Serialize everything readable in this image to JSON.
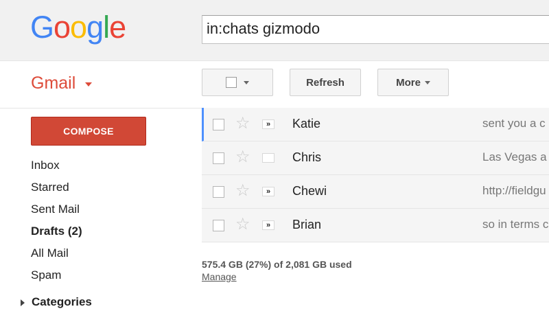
{
  "logo": {
    "letters": [
      "G",
      "o",
      "o",
      "g",
      "l",
      "e"
    ],
    "colors": [
      "#4285f4",
      "#ea4335",
      "#fbbc05",
      "#4285f4",
      "#34a853",
      "#ea4335"
    ]
  },
  "search": {
    "value": "in:chats gizmodo"
  },
  "app": {
    "label": "Gmail",
    "accent": "#dd4b39"
  },
  "toolbar": {
    "refresh_label": "Refresh",
    "more_label": "More"
  },
  "compose": {
    "label": "COMPOSE",
    "color": "#d14836"
  },
  "nav": {
    "items": [
      {
        "label": "Inbox"
      },
      {
        "label": "Starred"
      },
      {
        "label": "Sent Mail"
      },
      {
        "label": "Drafts (2)"
      },
      {
        "label": "All Mail"
      },
      {
        "label": "Spam"
      }
    ],
    "categories_label": "Categories"
  },
  "messages": [
    {
      "sender": "Katie",
      "snippet": "sent you a c",
      "important_icon": "»"
    },
    {
      "sender": "Chris",
      "snippet": "Las Vegas a",
      "important_icon": ""
    },
    {
      "sender": "Chewi",
      "snippet": "http://fieldgu",
      "important_icon": "»"
    },
    {
      "sender": "Brian",
      "snippet": "so in terms c",
      "important_icon": "»"
    }
  ],
  "footer": {
    "storage": "575.4 GB (27%) of 2,081 GB used",
    "manage_label": "Manage"
  }
}
